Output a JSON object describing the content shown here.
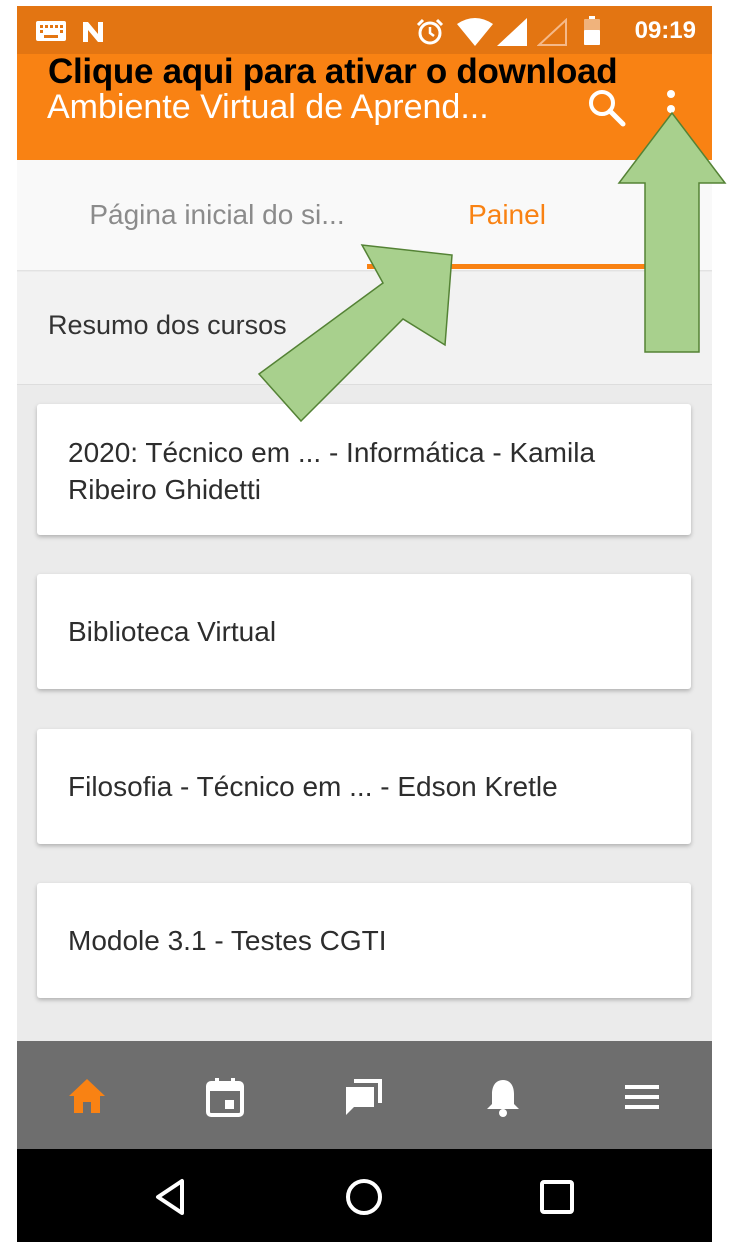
{
  "status_bar": {
    "time": "09:19",
    "icons": [
      "keyboard-icon",
      "n-notification-icon",
      "alarm-icon",
      "wifi-icon",
      "signal-icon",
      "signal-empty-icon",
      "battery-icon"
    ]
  },
  "app_bar": {
    "title": "Ambiente Virtual de Aprend...",
    "actions": [
      "search-icon",
      "more-vert-icon"
    ]
  },
  "tabs": [
    {
      "label": "Página inicial do si...",
      "active": false
    },
    {
      "label": "Painel",
      "active": true
    }
  ],
  "section": {
    "title": "Resumo dos cursos"
  },
  "courses": [
    {
      "title": "2020: Técnico em ... - Informática - Kamila Ribeiro Ghidetti"
    },
    {
      "title": "Biblioteca Virtual"
    },
    {
      "title": "Filosofia - Técnico em ... - Edson Kretle"
    },
    {
      "title": "Modole 3.1 - Testes CGTI"
    }
  ],
  "bottom_nav": {
    "items": [
      "home-icon",
      "calendar-icon",
      "messages-icon",
      "notifications-icon",
      "hamburger-menu-icon"
    ],
    "active_index": 0
  },
  "system_nav": [
    "back-icon",
    "home-circle-icon",
    "recents-icon"
  ],
  "overlay": {
    "text": "Clique aqui para ativar o download",
    "arrows": [
      "arrow-to-painel-tab",
      "arrow-to-more-menu"
    ]
  },
  "colors": {
    "primary": "#f98213",
    "status_bar": "#e37512",
    "bottom_nav": "#6e6e6e",
    "arrow_fill": "#a8d08d",
    "arrow_stroke": "#548235"
  }
}
